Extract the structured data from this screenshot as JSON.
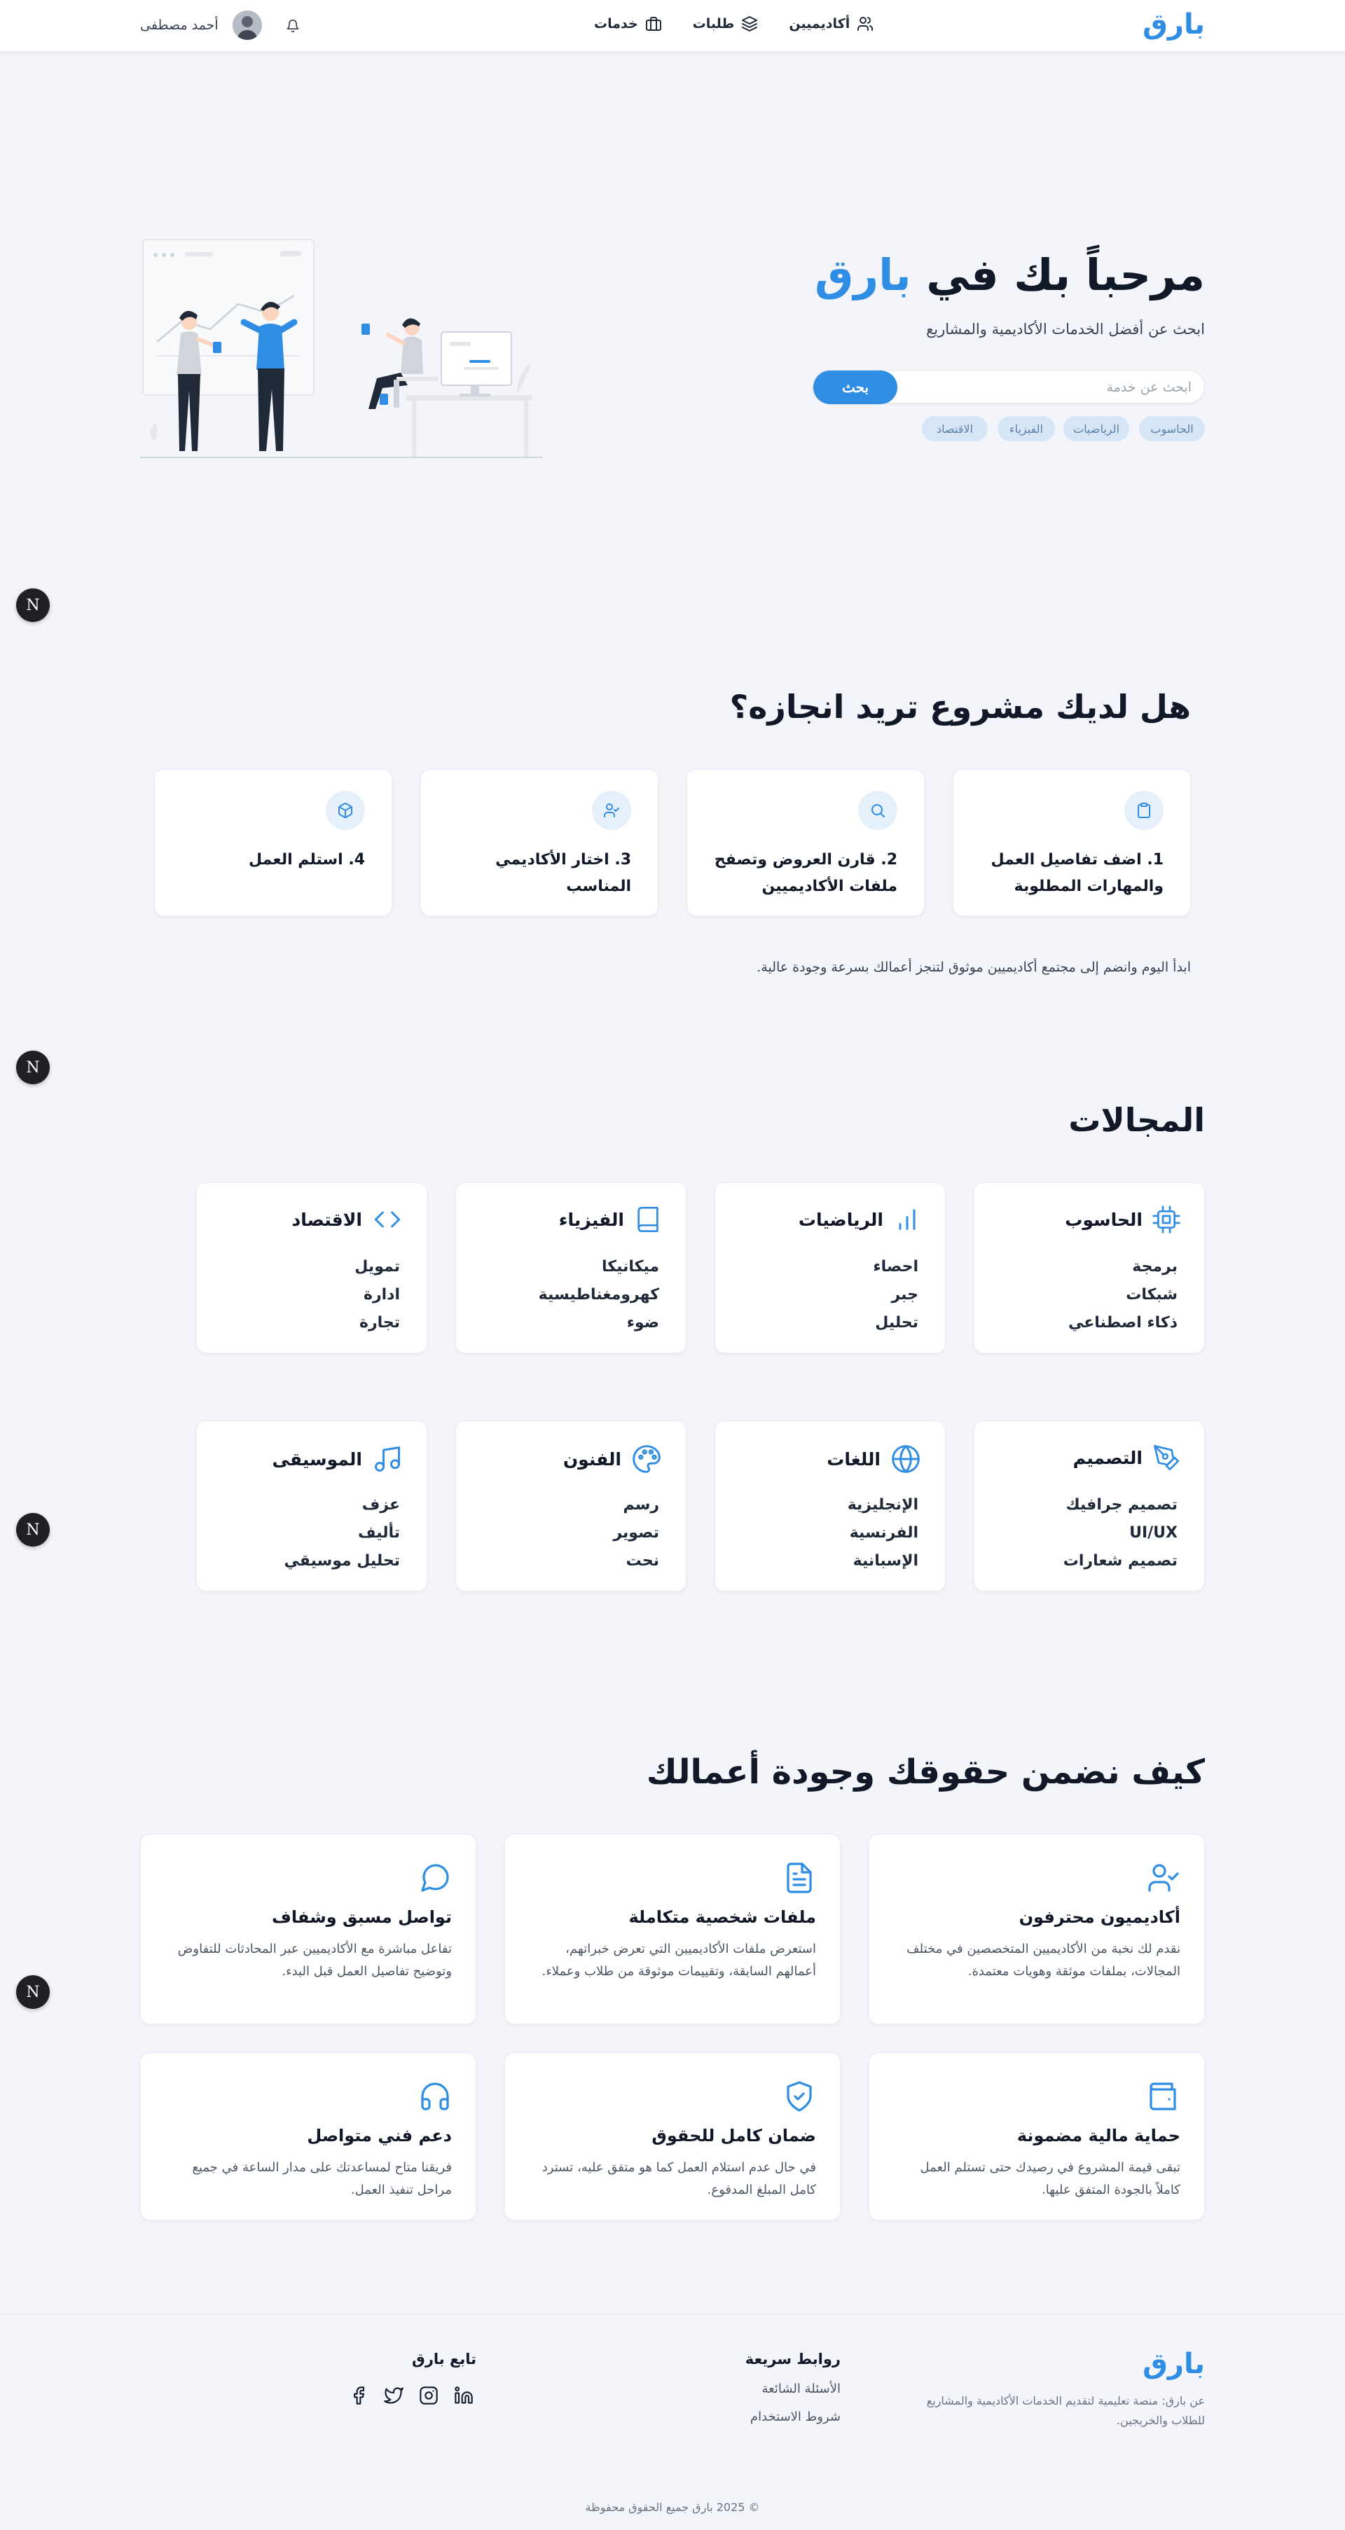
{
  "header": {
    "logo": "بارق",
    "nav": [
      {
        "label": "خدمات",
        "icon": "briefcase-icon"
      },
      {
        "label": "طلبات",
        "icon": "layers-icon"
      },
      {
        "label": "أكاديميين",
        "icon": "users-icon"
      }
    ],
    "user_name": "أحمد مصطفى",
    "icons": {
      "bell": "bell-icon",
      "avatar": "avatar"
    }
  },
  "hero": {
    "title_prefix": "مرحباً بك في ",
    "title_brand": "بارق",
    "subtitle": "ابحث عن أفضل الخدمات الأكاديمية والمشاريع",
    "search_placeholder": "ابحث عن خدمة",
    "search_button": "بحث",
    "chips": [
      "الحاسوب",
      "الرياضيات",
      "الفيزياء",
      "الاقتصاد"
    ]
  },
  "badge_letter": "N",
  "steps": {
    "title": "هل لديك مشروع تريد انجازه؟",
    "items": [
      {
        "text": "1. اضف تفاصيل العمل والمهارات المطلوبة",
        "icon": "clipboard-icon"
      },
      {
        "text": "2. قارن العروض وتصفح ملفات الأكاديميين",
        "icon": "search-icon"
      },
      {
        "text": "3. اختار الأكاديمي المناسب",
        "icon": "user-check-icon"
      },
      {
        "text": "4. استلم العمل",
        "icon": "package-icon"
      }
    ],
    "note": "ابدأ اليوم وانضم إلى مجتمع أكاديميين موثوق لتنجز أعمالك بسرعة وجودة عالية."
  },
  "fields": {
    "title": "المجالات",
    "items": [
      {
        "name": "الحاسوب",
        "icon": "cpu-icon",
        "subs": [
          "برمجة",
          "شبكات",
          "ذكاء اصطناعي"
        ]
      },
      {
        "name": "الرياضيات",
        "icon": "bar-chart-icon",
        "subs": [
          "احصاء",
          "جبر",
          "تحليل"
        ]
      },
      {
        "name": "الفيزياء",
        "icon": "book-icon",
        "subs": [
          "ميكانيكا",
          "كهرومغناطيسية",
          "ضوء"
        ]
      },
      {
        "name": "الاقتصاد",
        "icon": "code-icon",
        "subs": [
          "تمويل",
          "ادارة",
          "تجارة"
        ]
      },
      {
        "name": "التصميم",
        "icon": "pen-tool-icon",
        "subs": [
          "تصميم جرافيك",
          "UI/UX",
          "تصميم شعارات"
        ]
      },
      {
        "name": "اللغات",
        "icon": "globe-icon",
        "subs": [
          "الإنجليزية",
          "الفرنسية",
          "الإسبانية"
        ]
      },
      {
        "name": "الفنون",
        "icon": "palette-icon",
        "subs": [
          "رسم",
          "تصوير",
          "نحت"
        ]
      },
      {
        "name": "الموسيقى",
        "icon": "music-icon",
        "subs": [
          "عزف",
          "تأليف",
          "تحليل موسيقي"
        ]
      }
    ]
  },
  "guarantees": {
    "title": "كيف نضمن حقوقك وجودة أعمالك",
    "items": [
      {
        "title": "أكاديميون محترفون",
        "desc": "نقدم لك نخبة من الأكاديميين المتخصصين في مختلف المجالات، بملفات موثقة وهويات معتمدة.",
        "icon": "user-check-icon"
      },
      {
        "title": "ملفات شخصية متكاملة",
        "desc": "استعرض ملفات الأكاديميين التي تعرض خبراتهم، أعمالهم السابقة، وتقييمات موثوقة من طلاب وعملاء.",
        "icon": "file-text-icon"
      },
      {
        "title": "تواصل مسبق وشفاف",
        "desc": "تفاعل مباشرة مع الأكاديميين عبر المحادثات للتفاوض وتوضيح تفاصيل العمل قبل البدء.",
        "icon": "message-circle-icon"
      },
      {
        "title": "حماية مالية مضمونة",
        "desc": "تبقى قيمة المشروع في رصيدك حتى تستلم العمل كاملاً بالجودة المتفق عليها.",
        "icon": "wallet-icon"
      },
      {
        "title": "ضمان كامل للحقوق",
        "desc": "في حال عدم استلام العمل كما هو متفق عليه، تسترد كامل المبلغ المدفوع.",
        "icon": "shield-check-icon"
      },
      {
        "title": "دعم فني متواصل",
        "desc": "فريقنا متاح لمساعدتك على مدار الساعة في جميع مراحل تنفيذ العمل.",
        "icon": "headphones-icon"
      }
    ]
  },
  "footer": {
    "logo": "بارق",
    "about": "عن بارق: منصة تعليمية لتقديم الخدمات الأكاديمية والمشاريع للطلاب والخريجين.",
    "quick_links_title": "روابط سريعة",
    "quick_links": [
      "الأسئلة الشائعة",
      "شروط الاستخدام"
    ],
    "follow_title": "تابع بارق",
    "social": [
      "facebook-icon",
      "twitter-icon",
      "instagram-icon",
      "linkedin-icon"
    ],
    "copyright": "© 2025 بارق جميع الحقوق محفوظة"
  }
}
